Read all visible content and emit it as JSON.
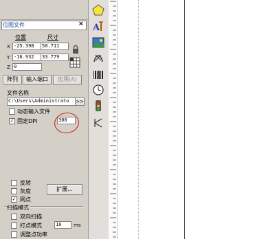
{
  "panel": {
    "title": "位图文件",
    "close_glyph": "×",
    "position_label": "位置",
    "size_label": "尺寸",
    "x_axis": "X",
    "y_axis": "Y",
    "z_axis": "Z",
    "x_pos": "-25.398",
    "y_pos": "-16.932",
    "z_pos": "0",
    "width": "50.711",
    "height": "33.779",
    "array_button": "阵列",
    "port_button": "输入端口",
    "apply_button": "应用(A)",
    "filename_label": "文件名称",
    "filename_value": "C:\\Users\\Administrato",
    "browse_button": ">>",
    "dynamic_file_label": "动态输入文件",
    "dynamic_file_checked": false,
    "fixed_dpi_label": "固定DPI",
    "fixed_dpi_checked": true,
    "dpi_value": "300",
    "invert_label": "反转",
    "invert_checked": false,
    "gray_label": "灰度",
    "gray_checked": false,
    "dither_label": "网点",
    "dither_checked": true,
    "extend_button": "扩展...",
    "scan_mode_label": "扫描模式",
    "bidirectional_label": "双向扫描",
    "bidirectional_checked": false,
    "dot_mode_label": "打点模式",
    "dot_mode_checked": false,
    "dot_mode_value": "10",
    "dot_mode_unit": "ms",
    "adjust_power_label": "调整点功率",
    "adjust_power_checked": false
  },
  "toolbar": {
    "tools": [
      "polygon-icon",
      "text-tool-icon",
      "bitmap-icon",
      "vector-file-icon",
      "barcode-icon",
      "delay-timer-icon",
      "io-signal-icon",
      "motion-axis-icon"
    ]
  },
  "colors": {
    "panel_bg": "#d4d0c8",
    "annotation_circle": "#d01818",
    "title_text": "#1a4aa0"
  }
}
